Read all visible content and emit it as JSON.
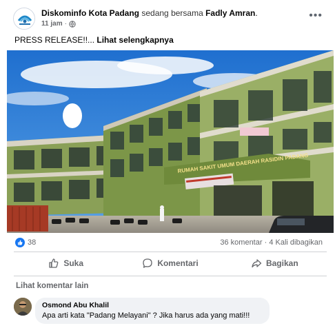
{
  "post": {
    "page_name": "Diskominfo Kota Padang",
    "with_text": "sedang bersama",
    "tagged_name": "Fadly Amran",
    "tagged_suffix": ".",
    "time": "11 jam",
    "separator": "·",
    "privacy_icon": "globe-icon",
    "more_icon": "more-options-icon",
    "text_prefix": "PRESS RELEASE!!...",
    "text_link": "Lihat selengkapnya"
  },
  "photo": {
    "sign_text": "RUMAH SAKIT UMUM DAERAH RASIDIN PADANG",
    "banner_text": "RSUD Rasidin"
  },
  "stats": {
    "reaction_icon": "like-reaction-icon",
    "reactions_count": "38",
    "comments": "36 komentar",
    "shares": "4 Kali dibagikan",
    "stat_sep": "·"
  },
  "actions": {
    "like_label": "Suka",
    "comment_label": "Komentari",
    "share_label": "Bagikan"
  },
  "comments": {
    "see_more": "Lihat komentar lain",
    "items": [
      {
        "author": "Osmond Abu Khalil",
        "text": "Apa arti kata \"Padang Melayani\" ? Jika harus ada yang mati!!!"
      }
    ]
  },
  "colors": {
    "accent": "#1877f2",
    "secondary_text": "#65676b",
    "building_green": "#6b8a3a",
    "sky": "#2e7fd6"
  }
}
